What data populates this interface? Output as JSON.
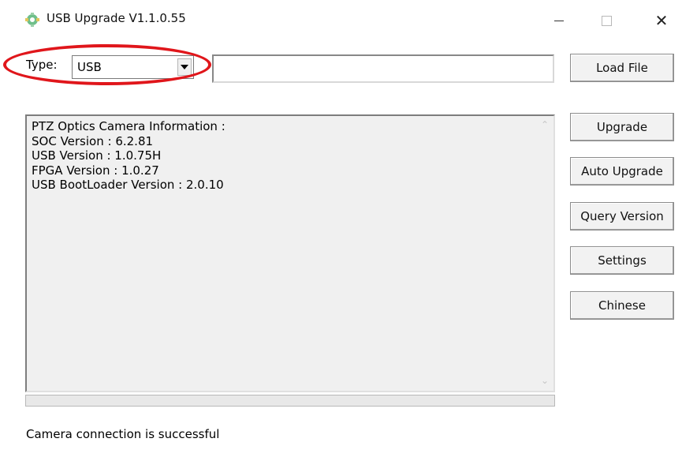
{
  "window": {
    "title": "USB Upgrade V1.1.0.55",
    "icon": "app-gear-icon",
    "controls": {
      "minimize": "minimize-icon",
      "maximize": "maximize-icon",
      "close": "✕"
    }
  },
  "type_row": {
    "label": "Type:",
    "selected": "USB",
    "path_value": "",
    "highlight_color": "#e0161b"
  },
  "buttons": {
    "load_file": "Load File",
    "upgrade": "Upgrade",
    "auto_upgrade": "Auto Upgrade",
    "query_version": "Query Version",
    "settings": "Settings",
    "chinese": "Chinese"
  },
  "info": {
    "lines": [
      "PTZ Optics Camera Information :",
      "SOC Version : 6.2.81",
      "USB Version : 1.0.75H",
      "FPGA Version : 1.0.27",
      "USB BootLoader Version : 2.0.10"
    ]
  },
  "progress": {
    "value": 0
  },
  "status": {
    "text": "Camera connection is successful"
  }
}
